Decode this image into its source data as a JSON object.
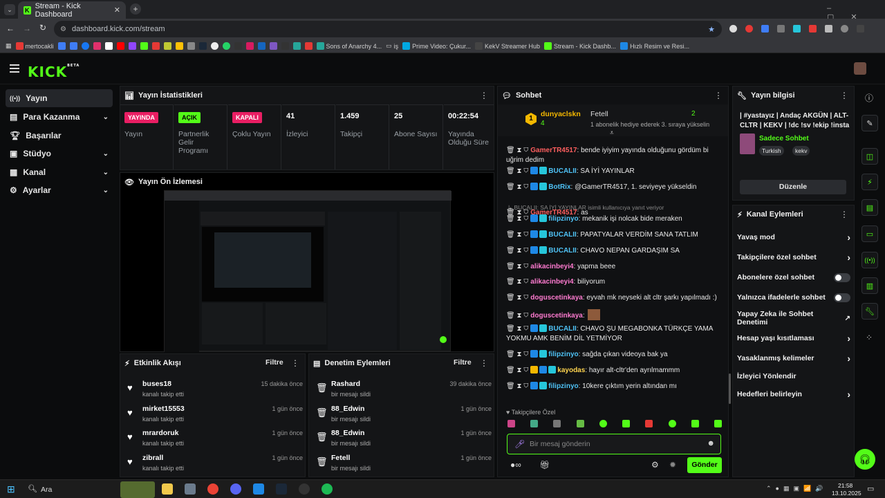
{
  "browser": {
    "tab_title": "Stream - Kick Dashboard",
    "url": "dashboard.kick.com/stream"
  },
  "bookmarks": [
    "mertocakli",
    "Sons of Anarchy 4...",
    "iş",
    "Prime Video: Çukur...",
    "KekV Streamer Hub",
    "Stream - Kick Dashb...",
    "Hızlı Resim ve Resi..."
  ],
  "app": {
    "logo": "KICK",
    "logo_sup": "BETA"
  },
  "sidebar": [
    {
      "label": "Yayın"
    },
    {
      "label": "Para Kazanma"
    },
    {
      "label": "Başarılar"
    },
    {
      "label": "Stüdyo"
    },
    {
      "label": "Kanal"
    },
    {
      "label": "Ayarlar"
    }
  ],
  "stats": {
    "title": "Yayın İstatistikleri",
    "items": [
      {
        "value": "YAYINDA",
        "label": "Yayın",
        "color": "#e91e63"
      },
      {
        "value": "AÇIK",
        "label": "Partnerlik Gelir Programı",
        "color": "#53fc18"
      },
      {
        "value": "KAPALI",
        "label": "Çoklu Yayın",
        "color": "#e91e63"
      },
      {
        "value": "41",
        "label": "İzleyici"
      },
      {
        "value": "1.459",
        "label": "Takipçi"
      },
      {
        "value": "25",
        "label": "Abone Sayısı"
      },
      {
        "value": "00:22:54",
        "label": "Yayında Olduğu Süre"
      }
    ]
  },
  "preview": {
    "title": "Yayın Ön İzlemesi"
  },
  "activity": {
    "title": "Etkinlik Akışı",
    "filter": "Filtre",
    "items": [
      {
        "name": "buses18",
        "sub": "kanalı takip etti",
        "time": "15 dakika önce"
      },
      {
        "name": "mirket15553",
        "sub": "kanalı takip etti",
        "time": "1 gün önce"
      },
      {
        "name": "mrardoruk",
        "sub": "kanalı takip etti",
        "time": "1 gün önce"
      },
      {
        "name": "zibrall",
        "sub": "kanalı takip etti",
        "time": "1 gün önce"
      }
    ]
  },
  "moderation": {
    "title": "Denetim Eylemleri",
    "filter": "Filtre",
    "items": [
      {
        "name": "Rashard",
        "sub": "bir mesajı sildi",
        "time": "39 dakika önce"
      },
      {
        "name": "88_Edwin",
        "sub": "bir mesajı sildi",
        "time": "1 gün önce"
      },
      {
        "name": "88_Edwin",
        "sub": "bir mesajı sildi",
        "time": "1 gün önce"
      },
      {
        "name": "Fetell",
        "sub": "bir mesajı sildi",
        "time": "1 gün önce"
      }
    ]
  },
  "chat": {
    "title": "Sohbet",
    "leader": {
      "rank": "1",
      "name": "dunyaclskn",
      "count": "4",
      "user2": "Fetell",
      "user2_count": "2",
      "gift_note": "1 abonelik hediye ederek 3. sıraya yükselin"
    },
    "messages": [
      {
        "user": "GamerTR4517",
        "text": "bende iyiyim yayında olduğunu gördüm bi uğrim dedim",
        "color": "#ff5f5f"
      },
      {
        "user": "BUCALII",
        "text": "SA İYİ YAYINLAR",
        "color": "#4fc3f7"
      },
      {
        "user": "BotRix",
        "text": "@GamerTR4517, 1. seviyeye yükseldin",
        "color": "#4fc3f7"
      },
      {
        "user": "GamerTR4517",
        "text": "as",
        "color": "#ff5f5f",
        "reply": "BUCALII: SA İYİ YAYINLAR isimli kullanıcıya yanıt veriyor"
      },
      {
        "user": "filipzinyo",
        "text": "mekanik işi nolcak bide meraken",
        "color": "#4fc3f7"
      },
      {
        "user": "BUCALII",
        "text": "PAPATYALAR VERDİM SANA TATLIM",
        "color": "#4fc3f7"
      },
      {
        "user": "BUCALII",
        "text": "CHAVO NEPAN GARDAŞIM SA",
        "color": "#4fc3f7"
      },
      {
        "user": "alikacinbeyi4",
        "text": "yapma beee",
        "color": "#ff7bd0"
      },
      {
        "user": "alikacinbeyi4",
        "text": "biliyorum",
        "color": "#ff7bd0"
      },
      {
        "user": "doguscetinkaya",
        "text": "eyvah mk neyseki alt cltr şarkı yapılmadı :)",
        "color": "#ff7bd0"
      },
      {
        "user": "doguscetinkaya",
        "text": "",
        "color": "#ff7bd0"
      },
      {
        "user": "BUCALII",
        "text": "CHAVO ŞU MEGABONKA TÜRKÇE YAMA YOKMU AMK BENİM DİL YETMİYOR",
        "color": "#4fc3f7"
      },
      {
        "user": "filipzinyo",
        "text": "sağda çıkan videoya bak ya",
        "color": "#4fc3f7"
      },
      {
        "user": "kayodas",
        "text": "hayır alt-cltr'den ayrılmammm",
        "color": "#ffd54f"
      },
      {
        "user": "filipzinyo",
        "text": "10kere çıktım yerin altından mı",
        "color": "#4fc3f7"
      }
    ],
    "followers_only": "Takipçilere Özel",
    "placeholder": "Bir mesaj gönderin",
    "send": "Gönder"
  },
  "stream_info": {
    "title": "Yayın bilgisi",
    "stream_title": "| #yastayız | Andaç AKGÜN | ALT-CLTR | KEKV | !dc !sv !ekip !insta",
    "category": "Sadece Sohbet",
    "tags": [
      "Turkish",
      "kekv"
    ],
    "edit": "Düzenle"
  },
  "channel_actions": {
    "title": "Kanal Eylemleri",
    "items": [
      {
        "label": "Yavaş mod",
        "kind": "chev"
      },
      {
        "label": "Takipçilere özel sohbet",
        "kind": "chev"
      },
      {
        "label": "Abonelere özel sohbet",
        "kind": "toggle"
      },
      {
        "label": "Yalnızca ifadelerle sohbet",
        "kind": "toggle"
      },
      {
        "label": "Yapay Zeka ile Sohbet Denetimi",
        "kind": "ext"
      },
      {
        "label": "Hesap yaşı kısıtlaması",
        "kind": "chev"
      },
      {
        "label": "Yasaklanmış kelimeler",
        "kind": "chev"
      },
      {
        "label": "İzleyici Yönlendir",
        "kind": "none"
      },
      {
        "label": "Hedefleri belirleyin",
        "kind": "chev"
      }
    ]
  },
  "taskbar": {
    "search": "Ara",
    "time": "21:58",
    "date": "13.10.2025"
  }
}
